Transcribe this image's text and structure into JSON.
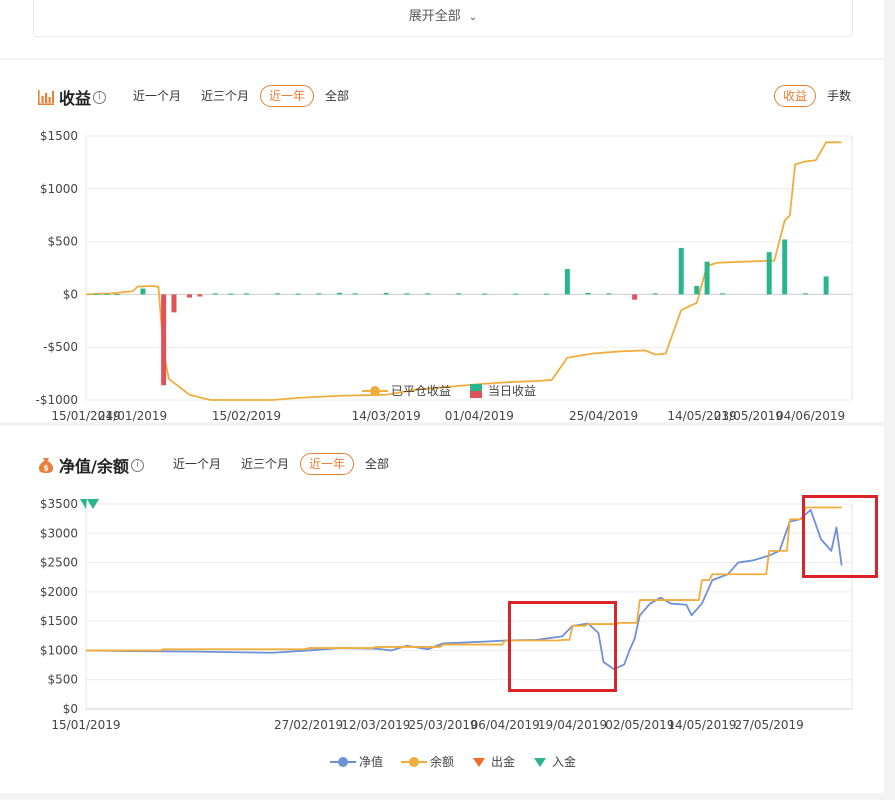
{
  "top": {
    "expand_label": "展开全部"
  },
  "profit": {
    "title": "收益",
    "tabs": [
      "近一个月",
      "近三个月",
      "近一年",
      "全部"
    ],
    "active_tab": 2,
    "mode_tabs": [
      "收益",
      "手数"
    ],
    "active_mode": 0
  },
  "nav": {
    "title": "净值/余额",
    "tabs": [
      "近一个月",
      "近三个月",
      "近一年",
      "全部"
    ],
    "active_tab": 2
  },
  "colors": {
    "accent": "#e8803a",
    "closed_profit_line": "#f0ad3c",
    "profit_up": "#2bb58c",
    "profit_down": "#e0525a",
    "nav_line": "#6f8fd6",
    "balance_line": "#f0ad3c",
    "withdraw": "#f36a22",
    "deposit": "#2bb58c",
    "highlight": "#d9252a"
  },
  "chart_data": [
    {
      "type": "bar",
      "title": "",
      "x_type": "date",
      "x_ticks": [
        "15/01/2019",
        "24/01/2019",
        "15/02/2019",
        "14/03/2019",
        "01/04/2019",
        "25/04/2019",
        "14/05/2019",
        "23/05/2019",
        "04/06/2019"
      ],
      "y_ticks": [
        "$1500",
        "$1000",
        "$500",
        "$0",
        "-$500",
        "-$1000"
      ],
      "ylim": [
        -1000,
        1500
      ],
      "grid": true,
      "legend": {
        "position": "bottom",
        "entries": [
          "已平仓收益",
          "当日收益"
        ]
      },
      "series": [
        {
          "name": "已平仓收益",
          "kind": "line",
          "points": [
            [
              "15/01/2019",
              0
            ],
            [
              "20/01/2019",
              10
            ],
            [
              "24/01/2019",
              30
            ],
            [
              "25/01/2019",
              75
            ],
            [
              "28/01/2019",
              80
            ],
            [
              "29/01/2019",
              70
            ],
            [
              "30/01/2019",
              -550
            ],
            [
              "31/01/2019",
              -800
            ],
            [
              "04/02/2019",
              -950
            ],
            [
              "08/02/2019",
              -1000
            ],
            [
              "20/02/2019",
              -1000
            ],
            [
              "25/02/2019",
              -980
            ],
            [
              "05/03/2019",
              -960
            ],
            [
              "14/03/2019",
              -950
            ],
            [
              "20/03/2019",
              -900
            ],
            [
              "25/03/2019",
              -880
            ],
            [
              "01/04/2019",
              -850
            ],
            [
              "07/04/2019",
              -830
            ],
            [
              "12/04/2019",
              -820
            ],
            [
              "15/04/2019",
              -810
            ],
            [
              "18/04/2019",
              -600
            ],
            [
              "23/04/2019",
              -560
            ],
            [
              "28/04/2019",
              -540
            ],
            [
              "03/05/2019",
              -530
            ],
            [
              "05/05/2019",
              -570
            ],
            [
              "07/05/2019",
              -560
            ],
            [
              "10/05/2019",
              -150
            ],
            [
              "13/05/2019",
              -80
            ],
            [
              "15/05/2019",
              270
            ],
            [
              "17/05/2019",
              300
            ],
            [
              "22/05/2019",
              310
            ],
            [
              "28/05/2019",
              320
            ],
            [
              "30/05/2019",
              700
            ],
            [
              "31/05/2019",
              750
            ],
            [
              "01/06/2019",
              1230
            ],
            [
              "03/06/2019",
              1260
            ],
            [
              "05/06/2019",
              1270
            ],
            [
              "07/06/2019",
              1440
            ],
            [
              "10/06/2019",
              1440
            ]
          ]
        },
        {
          "name": "当日收益",
          "kind": "bar",
          "points": [
            [
              "17/01/2019",
              5
            ],
            [
              "19/01/2019",
              5
            ],
            [
              "21/01/2019",
              3
            ],
            [
              "26/01/2019",
              55
            ],
            [
              "30/01/2019",
              -860
            ],
            [
              "01/02/2019",
              -170
            ],
            [
              "04/02/2019",
              -30
            ],
            [
              "06/02/2019",
              -20
            ],
            [
              "09/02/2019",
              10
            ],
            [
              "12/02/2019",
              8
            ],
            [
              "15/02/2019",
              10
            ],
            [
              "21/02/2019",
              10
            ],
            [
              "25/02/2019",
              8
            ],
            [
              "01/03/2019",
              10
            ],
            [
              "05/03/2019",
              15
            ],
            [
              "08/03/2019",
              10
            ],
            [
              "14/03/2019",
              15
            ],
            [
              "18/03/2019",
              10
            ],
            [
              "22/03/2019",
              10
            ],
            [
              "28/03/2019",
              10
            ],
            [
              "02/04/2019",
              8
            ],
            [
              "08/04/2019",
              8
            ],
            [
              "14/04/2019",
              8
            ],
            [
              "18/04/2019",
              240
            ],
            [
              "22/04/2019",
              15
            ],
            [
              "26/04/2019",
              10
            ],
            [
              "01/05/2019",
              -50
            ],
            [
              "05/05/2019",
              10
            ],
            [
              "10/05/2019",
              440
            ],
            [
              "13/05/2019",
              80
            ],
            [
              "15/05/2019",
              310
            ],
            [
              "18/05/2019",
              10
            ],
            [
              "27/05/2019",
              400
            ],
            [
              "30/05/2019",
              520
            ],
            [
              "03/06/2019",
              10
            ],
            [
              "07/06/2019",
              170
            ]
          ]
        }
      ]
    },
    {
      "type": "line",
      "title": "",
      "x_type": "date",
      "x_ticks": [
        "15/01/2019",
        "27/02/2019",
        "12/03/2019",
        "25/03/2019",
        "06/04/2019",
        "19/04/2019",
        "02/05/2019",
        "14/05/2019",
        "27/05/2019"
      ],
      "y_ticks": [
        "$3500",
        "$3000",
        "$2500",
        "$2000",
        "$1500",
        "$1000",
        "$500",
        "$0"
      ],
      "ylim": [
        0,
        3500
      ],
      "grid": true,
      "legend": {
        "position": "bottom",
        "entries": [
          "净值",
          "余额",
          "出金",
          "入金"
        ]
      },
      "series": [
        {
          "name": "净值",
          "kind": "line",
          "points": [
            [
              "15/01/2019",
              1000
            ],
            [
              "22/01/2019",
              990
            ],
            [
              "05/02/2019",
              980
            ],
            [
              "20/02/2019",
              960
            ],
            [
              "27/02/2019",
              1000
            ],
            [
              "05/03/2019",
              1040
            ],
            [
              "12/03/2019",
              1030
            ],
            [
              "15/03/2019",
              1000
            ],
            [
              "18/03/2019",
              1080
            ],
            [
              "22/03/2019",
              1020
            ],
            [
              "25/03/2019",
              1120
            ],
            [
              "02/04/2019",
              1150
            ],
            [
              "06/04/2019",
              1170
            ],
            [
              "12/04/2019",
              1180
            ],
            [
              "17/04/2019",
              1240
            ],
            [
              "19/04/2019",
              1420
            ],
            [
              "22/04/2019",
              1460
            ],
            [
              "24/04/2019",
              1300
            ],
            [
              "25/04/2019",
              800
            ],
            [
              "27/04/2019",
              680
            ],
            [
              "29/04/2019",
              760
            ],
            [
              "30/04/2019",
              1000
            ],
            [
              "01/05/2019",
              1200
            ],
            [
              "02/05/2019",
              1600
            ],
            [
              "04/05/2019",
              1800
            ],
            [
              "06/05/2019",
              1900
            ],
            [
              "08/05/2019",
              1800
            ],
            [
              "11/05/2019",
              1780
            ],
            [
              "12/05/2019",
              1600
            ],
            [
              "14/05/2019",
              1800
            ],
            [
              "16/05/2019",
              2200
            ],
            [
              "19/05/2019",
              2300
            ],
            [
              "21/05/2019",
              2500
            ],
            [
              "24/05/2019",
              2540
            ],
            [
              "27/05/2019",
              2620
            ],
            [
              "29/05/2019",
              2700
            ],
            [
              "31/05/2019",
              3200
            ],
            [
              "02/06/2019",
              3240
            ],
            [
              "04/06/2019",
              3400
            ],
            [
              "06/06/2019",
              2900
            ],
            [
              "08/06/2019",
              2700
            ],
            [
              "09/06/2019",
              3100
            ],
            [
              "10/06/2019",
              2450
            ]
          ]
        },
        {
          "name": "余额",
          "kind": "step",
          "points": [
            [
              "15/01/2019",
              1000
            ],
            [
              "26/01/2019",
              1000
            ],
            [
              "30/01/2019",
              1020
            ],
            [
              "27/02/2019",
              1040
            ],
            [
              "12/03/2019",
              1060
            ],
            [
              "25/03/2019",
              1100
            ],
            [
              "06/04/2019",
              1170
            ],
            [
              "17/04/2019",
              1180
            ],
            [
              "19/04/2019",
              1420
            ],
            [
              "22/04/2019",
              1450
            ],
            [
              "28/04/2019",
              1470
            ],
            [
              "02/05/2019",
              1860
            ],
            [
              "14/05/2019",
              2200
            ],
            [
              "16/05/2019",
              2300
            ],
            [
              "27/05/2019",
              2700
            ],
            [
              "31/05/2019",
              3240
            ],
            [
              "03/06/2019",
              3440
            ],
            [
              "10/06/2019",
              3440
            ]
          ]
        },
        {
          "name": "入金",
          "kind": "marker",
          "points": [
            [
              "15/01/2019",
              3500
            ]
          ]
        }
      ]
    }
  ]
}
